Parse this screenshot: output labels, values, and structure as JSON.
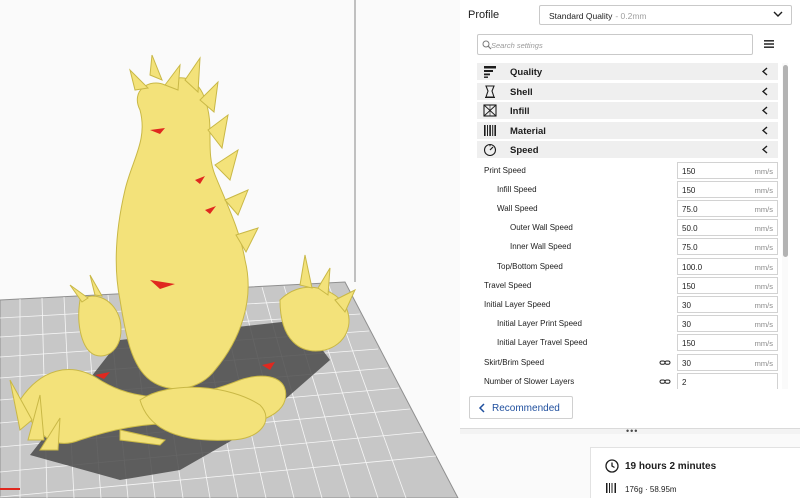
{
  "profile": {
    "label": "Profile",
    "value": "Standard Quality",
    "sub": "- 0.2mm"
  },
  "search": {
    "placeholder": "Search settings"
  },
  "categories": [
    {
      "label": "Quality",
      "icon": "quality-icon"
    },
    {
      "label": "Shell",
      "icon": "shell-icon"
    },
    {
      "label": "Infill",
      "icon": "infill-icon"
    },
    {
      "label": "Material",
      "icon": "material-icon"
    },
    {
      "label": "Speed",
      "icon": "speed-icon"
    }
  ],
  "settings": [
    {
      "name": "Print Speed",
      "value": "150",
      "unit": "mm/s",
      "indent": 0,
      "linked": false
    },
    {
      "name": "Infill Speed",
      "value": "150",
      "unit": "mm/s",
      "indent": 1,
      "linked": false
    },
    {
      "name": "Wall Speed",
      "value": "75.0",
      "unit": "mm/s",
      "indent": 1,
      "linked": false
    },
    {
      "name": "Outer Wall Speed",
      "value": "50.0",
      "unit": "mm/s",
      "indent": 2,
      "linked": false
    },
    {
      "name": "Inner Wall Speed",
      "value": "75.0",
      "unit": "mm/s",
      "indent": 2,
      "linked": false
    },
    {
      "name": "Top/Bottom Speed",
      "value": "100.0",
      "unit": "mm/s",
      "indent": 1,
      "linked": false
    },
    {
      "name": "Travel Speed",
      "value": "150",
      "unit": "mm/s",
      "indent": 0,
      "linked": false
    },
    {
      "name": "Initial Layer Speed",
      "value": "30",
      "unit": "mm/s",
      "indent": 0,
      "linked": false
    },
    {
      "name": "Initial Layer Print Speed",
      "value": "30",
      "unit": "mm/s",
      "indent": 1,
      "linked": false
    },
    {
      "name": "Initial Layer Travel Speed",
      "value": "150",
      "unit": "mm/s",
      "indent": 1,
      "linked": false
    },
    {
      "name": "Skirt/Brim Speed",
      "value": "30",
      "unit": "mm/s",
      "indent": 0,
      "linked": true
    },
    {
      "name": "Number of Slower Layers",
      "value": "2",
      "unit": "",
      "indent": 0,
      "linked": true
    }
  ],
  "recommended": {
    "label": "Recommended"
  },
  "print_info": {
    "time": "19 hours 2 minutes",
    "material": "176g · 58.95m"
  },
  "colors": {
    "accent": "#1f4f9e",
    "model": "#f3e27a",
    "overhang": "#e0281f",
    "bed": "#c9c9c9",
    "volume": "#9a9a9a"
  }
}
